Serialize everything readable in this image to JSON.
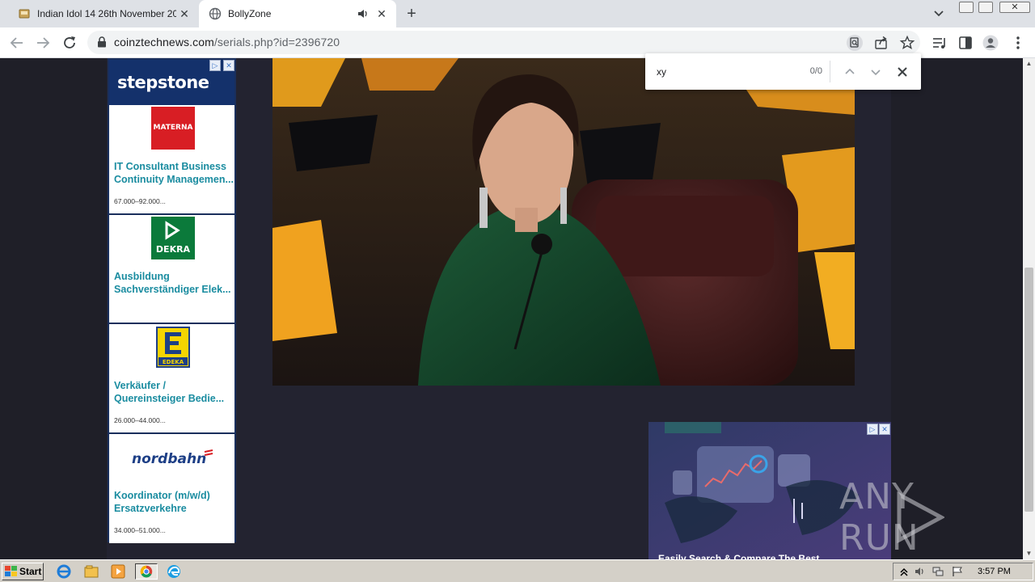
{
  "browser": {
    "tabs": [
      {
        "title": "Indian Idol 14 26th November 2023",
        "active": false
      },
      {
        "title": "BollyZone",
        "active": true,
        "audio": true
      }
    ],
    "url_host": "coinztechnews.com",
    "url_path": "/serials.php?id=2396720"
  },
  "find_bar": {
    "query": "xy",
    "count": "0/0"
  },
  "ads": {
    "brand": "stepstone",
    "choice_mark": "▷",
    "close_mark": "✕",
    "listings": [
      {
        "logo_text": "MATERNA",
        "logo_color": "#d81e24",
        "title_line1": "IT Consultant Business",
        "title_line2": "Continuity Managemen...",
        "salary": "67.000–92.000..."
      },
      {
        "logo_text": "DEKRA",
        "logo_color": "#0b7a3b",
        "title_line1": "Ausbildung",
        "title_line2": "Sachverständiger Elek...",
        "salary": ""
      },
      {
        "logo_text": "EDEKA",
        "logo_color": "#f5d400",
        "title_line1": "Verkäufer /",
        "title_line2": "Quereinsteiger Bedie...",
        "salary": "26.000–44.000..."
      },
      {
        "logo_text": "nordbahn",
        "logo_color": "#1d3f86",
        "title_line1": "Koordinator (m/w/d)",
        "title_line2": "Ersatzverkehre",
        "salary": "34.000–51.000..."
      }
    ],
    "bottom_text": "Easily Search & Compare The Best"
  },
  "watermark": "ANY RUN",
  "taskbar": {
    "start_label": "Start",
    "clock": "3:57 PM"
  },
  "colors": {
    "page_bg": "#1f1f28",
    "ad_brand_bg": "#14316b",
    "ad_title": "#1a8ca0"
  }
}
